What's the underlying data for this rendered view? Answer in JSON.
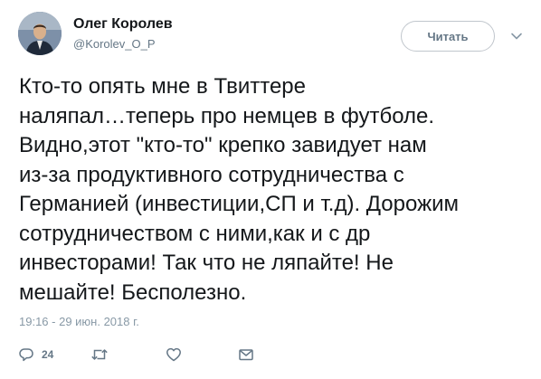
{
  "user": {
    "display_name": "Олег Королев",
    "screen_name": "@Korolev_O_P",
    "avatar_icon": "avatar-photo"
  },
  "header": {
    "follow_label": "Читать",
    "menu_icon": "chevron-down-icon"
  },
  "tweet": {
    "text": "Кто-то опять мне в Твиттере\nналяпал…теперь про немцев в футболе.\nВидно,этот  \"кто-то\" крепко завидует нам\nиз-за продуктивного сотрудничества  с\nГерманией (инвестиции,СП и т.д). Дорожим\nсотрудничеством с ними,как и с др\nинвесторами! Так что не ляпайте! Не\nмешайте! Бесполезно.",
    "timestamp": "19:16 - 29 июн. 2018 г."
  },
  "actions": {
    "reply_icon": "reply-icon",
    "reply_count": "24",
    "retweet_icon": "retweet-icon",
    "like_icon": "heart-icon",
    "dm_icon": "envelope-icon"
  },
  "colors": {
    "text": "#14171a",
    "secondary": "#657786",
    "timestamp": "#8899a6",
    "border": "#c0c6cc"
  }
}
